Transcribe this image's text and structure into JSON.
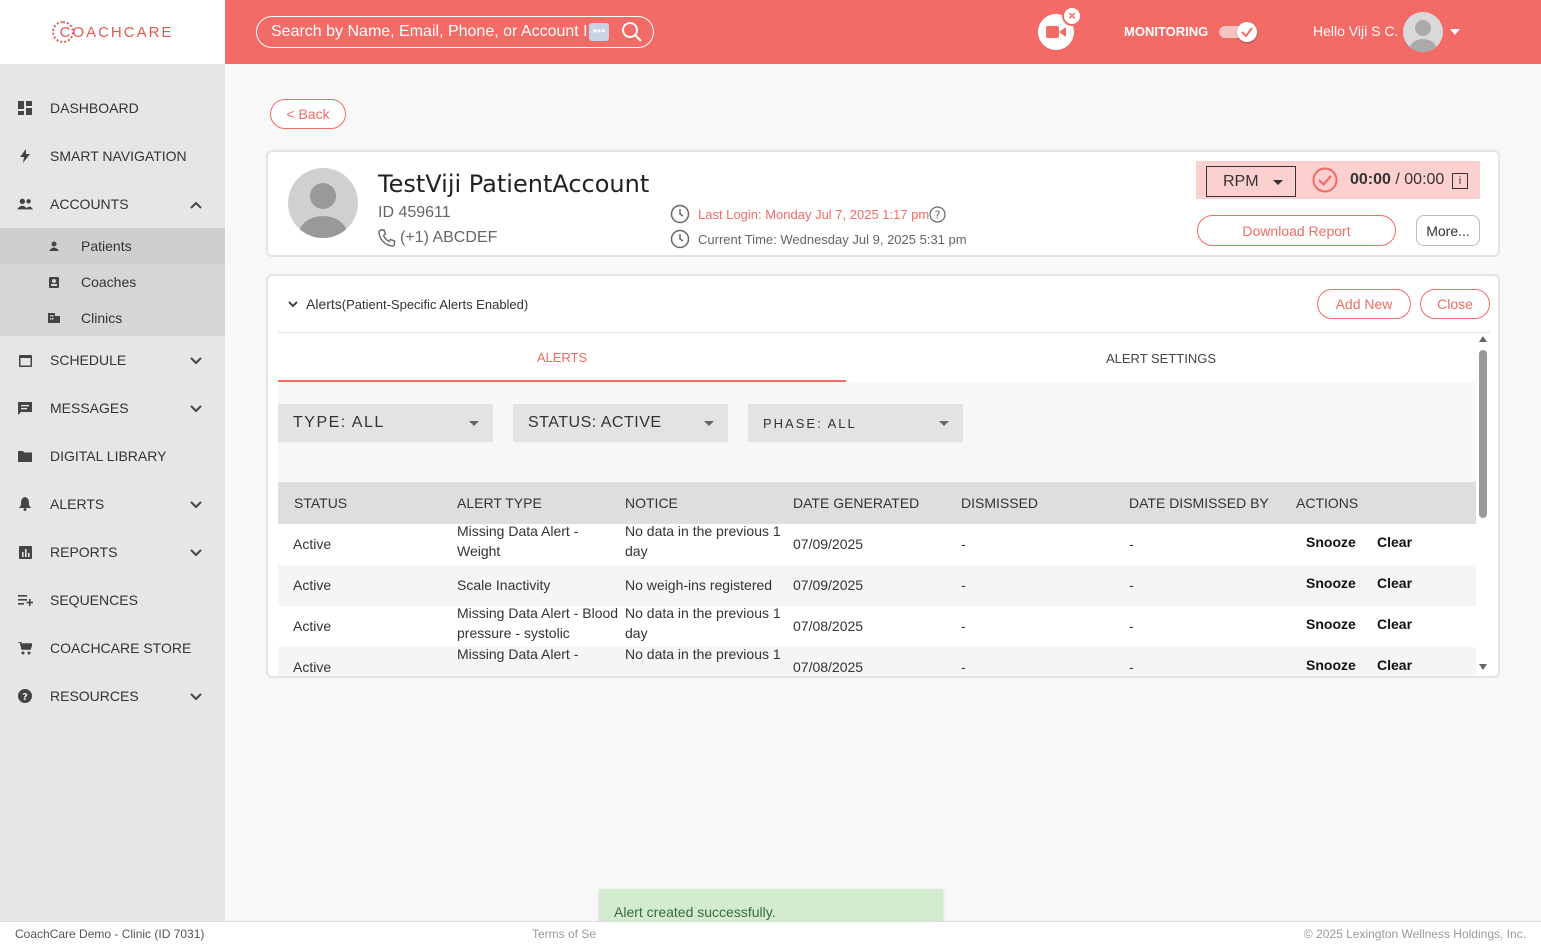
{
  "app": {
    "logo_text": "COACHCARE",
    "search_placeholder": "Search by Name, Email, Phone, or Account I",
    "monitoring_label": "MONITORING",
    "greeting": "Hello Viji S C."
  },
  "sidebar": {
    "items": [
      {
        "label": "DASHBOARD",
        "icon": "dashboard-icon"
      },
      {
        "label": "SMART NAVIGATION",
        "icon": "bolt-icon"
      },
      {
        "label": "ACCOUNTS",
        "icon": "people-icon",
        "expanded": true
      },
      {
        "label": "SCHEDULE",
        "icon": "calendar-icon"
      },
      {
        "label": "MESSAGES",
        "icon": "message-icon"
      },
      {
        "label": "DIGITAL LIBRARY",
        "icon": "folder-icon"
      },
      {
        "label": "ALERTS",
        "icon": "bell-icon"
      },
      {
        "label": "REPORTS",
        "icon": "chart-icon"
      },
      {
        "label": "SEQUENCES",
        "icon": "playlist-icon"
      },
      {
        "label": "COACHCARE STORE",
        "icon": "cart-icon"
      },
      {
        "label": "RESOURCES",
        "icon": "help-icon"
      }
    ],
    "sub_items": [
      {
        "label": "Patients",
        "icon": "person-icon"
      },
      {
        "label": "Coaches",
        "icon": "badge-icon"
      },
      {
        "label": "Clinics",
        "icon": "building-icon"
      }
    ]
  },
  "back_label": "< Back",
  "patient": {
    "name": "TestViji PatientAccount",
    "id": "ID 459611",
    "phone": "(+1) ABCDEF",
    "last_login": "Last Login: Monday Jul 7, 2025 1:17 pm",
    "current_time": "Current Time: Wednesday Jul 9, 2025 5:31 pm",
    "program": "RPM",
    "timer_current": "00:00",
    "timer_total": "/ 00:00",
    "info_icon": "i",
    "download_label": "Download Report",
    "more_label": "More..."
  },
  "alerts_panel": {
    "title": "Alerts",
    "subtitle": "(Patient-Specific Alerts Enabled)",
    "add_new_label": "Add New",
    "close_label": "Close",
    "tabs": [
      {
        "label": "ALERTS",
        "active": true
      },
      {
        "label": "ALERT SETTINGS",
        "active": false
      }
    ],
    "filters": {
      "type": "TYPE: ALL",
      "status": "STATUS: ACTIVE",
      "phase": "PHASE: ALL"
    },
    "columns": [
      "STATUS",
      "ALERT TYPE",
      "NOTICE",
      "DATE GENERATED",
      "DISMISSED",
      "DATE DISMISSED BY",
      "ACTIONS"
    ],
    "rows": [
      {
        "status": "Active",
        "type_line1": "Missing Data Alert -",
        "type_line2": "Weight",
        "notice_line1": "No data in the previous 1",
        "notice_line2": "day",
        "date": "07/09/2025",
        "dismissed": "-",
        "dismissed_by": "-",
        "snooze": "Snooze",
        "clear": "Clear"
      },
      {
        "status": "Active",
        "type_line1": "Scale Inactivity",
        "type_line2": "",
        "notice_line1": "No weigh-ins registered",
        "notice_line2": "",
        "date": "07/09/2025",
        "dismissed": "-",
        "dismissed_by": "-",
        "snooze": "Snooze",
        "clear": "Clear"
      },
      {
        "status": "Active",
        "type_line1": "Missing Data Alert - Blood",
        "type_line2": "pressure - systolic",
        "notice_line1": "No data in the previous 1",
        "notice_line2": "day",
        "date": "07/08/2025",
        "dismissed": "-",
        "dismissed_by": "-",
        "snooze": "Snooze",
        "clear": "Clear"
      },
      {
        "status": "Active",
        "type_line1": "Missing Data Alert -",
        "type_line2": "",
        "notice_line1": "No data in the previous 1",
        "notice_line2": "",
        "date": "07/08/2025",
        "dismissed": "-",
        "dismissed_by": "-",
        "snooze": "Snooze",
        "clear": "Clear"
      }
    ]
  },
  "toast": "Alert created successfully.",
  "footer": {
    "clinic": "CoachCare Demo - Clinic (ID 7031)",
    "links": "Terms of Se",
    "copyright": "2025 Lexington Wellness Holdings, Inc."
  },
  "colors": {
    "brand": "#f26b66",
    "toast_bg": "#d3ecd0"
  }
}
